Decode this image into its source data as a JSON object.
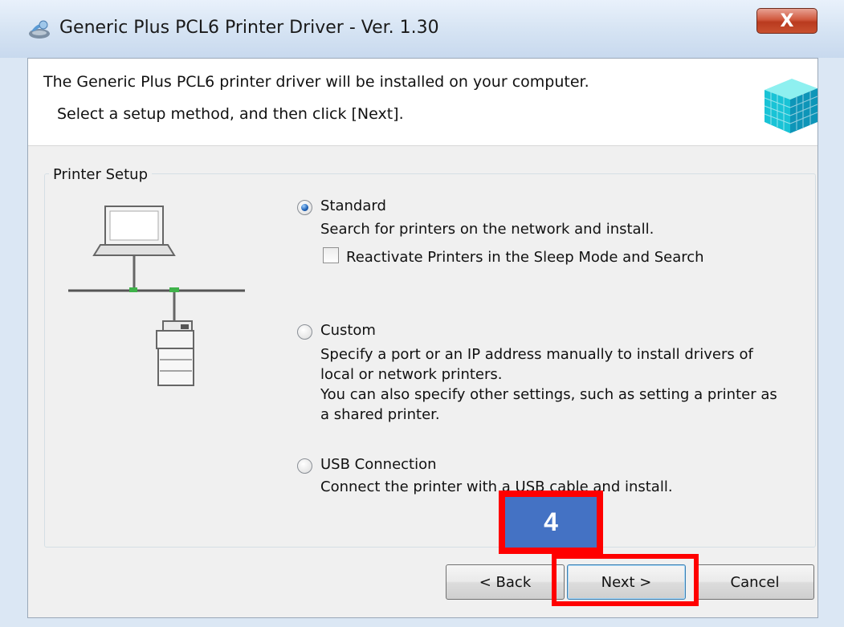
{
  "window": {
    "title": "Generic Plus PCL6 Printer Driver - Ver. 1.30",
    "close_label": "X"
  },
  "header": {
    "line1": "The Generic Plus PCL6 printer driver will be installed on your computer.",
    "line2": "Select a setup method, and then click [Next]."
  },
  "group": {
    "label": "Printer Setup"
  },
  "options": {
    "standard": {
      "label": "Standard",
      "selected": true,
      "desc": "Search for printers on the network and install.",
      "checkbox_label": "Reactivate Printers in the Sleep Mode and Search",
      "checkbox_checked": false
    },
    "custom": {
      "label": "Custom",
      "selected": false,
      "desc1": "Specify a port or an IP address manually to install drivers of",
      "desc2": "local or network printers.",
      "desc3": "You can also specify other settings, such as setting a printer as",
      "desc4": "a shared printer."
    },
    "usb": {
      "label": "USB Connection",
      "selected": false,
      "desc": "Connect the printer with a USB cable and install."
    }
  },
  "buttons": {
    "back": "< Back",
    "next": "Next >",
    "cancel": "Cancel"
  },
  "annotation": {
    "step": "4",
    "color": "#ff0000",
    "badge_color": "#4472c4"
  }
}
